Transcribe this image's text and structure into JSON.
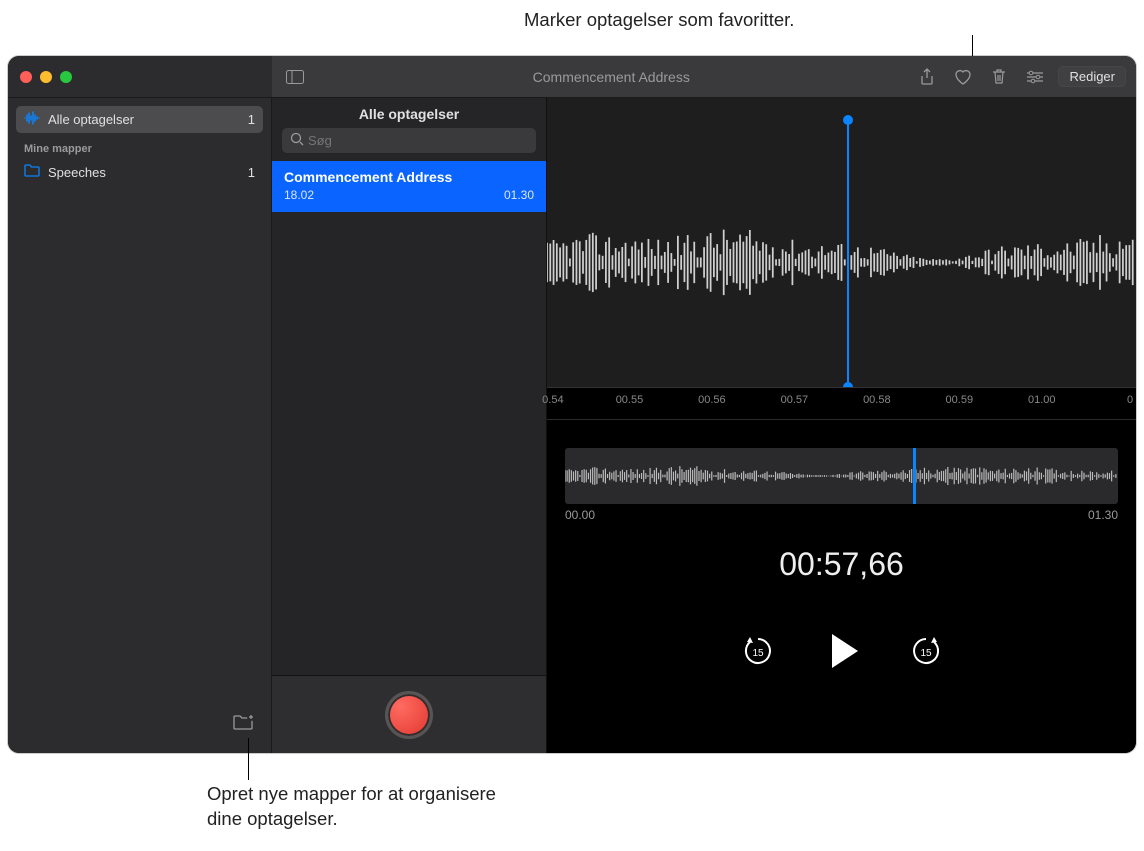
{
  "callouts": {
    "favorite": "Marker optagelser som favoritter.",
    "new_folder": "Opret nye mapper for at organisere dine optagelser."
  },
  "toolbar": {
    "title": "Commencement Address",
    "edit_label": "Rediger"
  },
  "sidebar": {
    "all_recordings_label": "Alle optagelser",
    "all_recordings_count": "1",
    "section_label": "Mine mapper",
    "folders": [
      {
        "name": "Speeches",
        "count": "1"
      }
    ]
  },
  "list": {
    "header": "Alle optagelser",
    "search_placeholder": "Søg",
    "items": [
      {
        "name": "Commencement Address",
        "date": "18.02",
        "duration": "01.30"
      }
    ]
  },
  "detail": {
    "ruler_ticks": [
      "0.54",
      "00.55",
      "00.56",
      "00.57",
      "00.58",
      "00.59",
      "01.00",
      "0"
    ],
    "overview_start": "00.00",
    "overview_end": "01.30",
    "current_time": "00:57,66",
    "skip_amount": "15"
  }
}
